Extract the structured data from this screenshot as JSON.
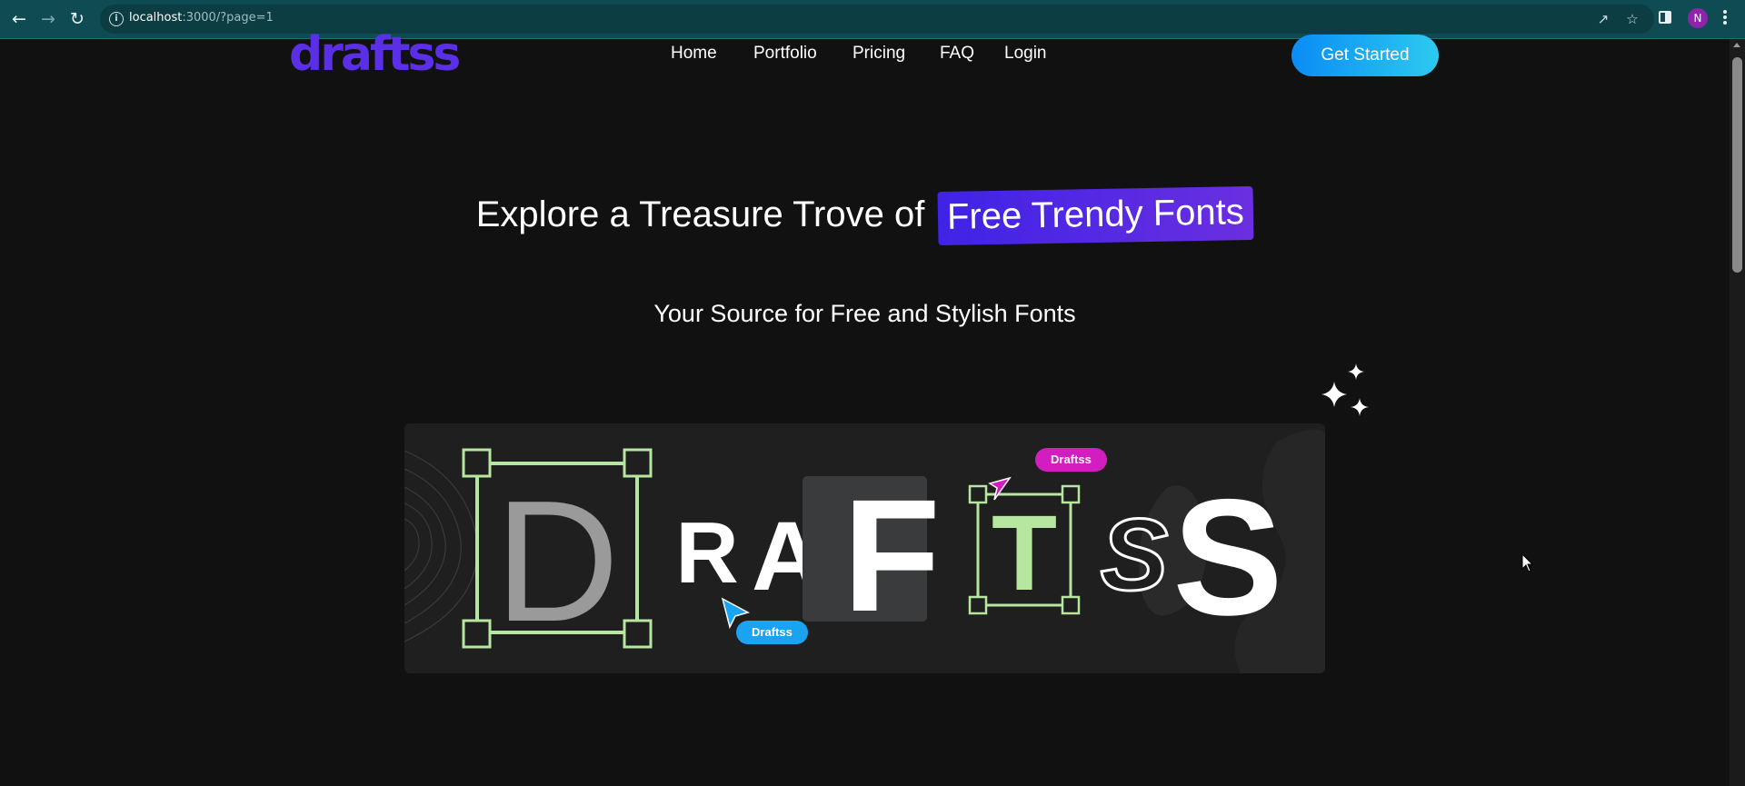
{
  "browser": {
    "url_host": "localhost",
    "url_rest": ":3000/?page=1",
    "avatar_letter": "N",
    "icons": [
      "back-arrow-icon",
      "forward-arrow-icon",
      "reload-icon",
      "info-icon",
      "share-icon",
      "star-icon",
      "side-panel-icon",
      "kebab-menu-icon"
    ]
  },
  "site": {
    "logo": "draftss",
    "nav": [
      "Home",
      "Portfolio",
      "Pricing",
      "FAQ",
      "Login"
    ],
    "cta": "Get Started",
    "colors": {
      "background": "#111111",
      "logo": "#5b2fe6",
      "highlight": "#4a25e6",
      "cta": "#0a8cf5"
    }
  },
  "hero": {
    "title_prefix": "Explore a Treasure Trove of ",
    "title_highlight": "Free Trendy Fonts",
    "subtitle": "Your Source for Free and Stylish Fonts"
  },
  "art": {
    "letters": [
      "D",
      "R",
      "A",
      "F",
      "T",
      "S",
      "S"
    ],
    "tag_blue": "Draftss",
    "tag_pink": "Draftss"
  }
}
